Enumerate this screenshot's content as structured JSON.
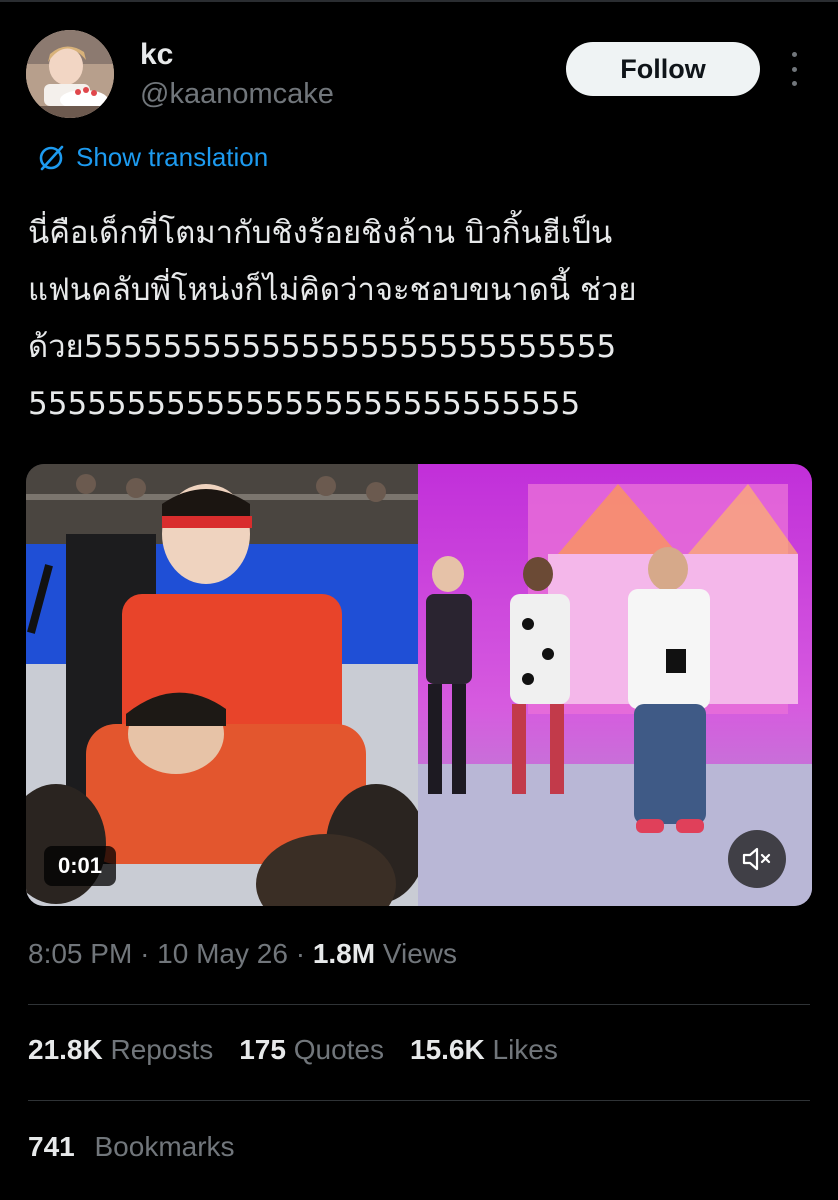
{
  "user": {
    "display_name": "kc",
    "handle": "@kaanomcake",
    "follow_label": "Follow"
  },
  "translation_label": "Show translation",
  "tweet_text": "นี่คือเด็กที่โตมากับชิงร้อยชิงล้าน บิวกิ้นฮีเป็น\nแฟนคลับพี่โหน่งก็ไม่คิดว่าจะชอบขนาดนี้ ช่วย\nด้วย555555555555555555555555555\n5555555555555555555555555555",
  "media": {
    "duration": "0:01"
  },
  "meta": {
    "time": "8:05 PM",
    "date": "10 May 26",
    "views_count": "1.8M",
    "views_label": "Views"
  },
  "stats": {
    "reposts_count": "21.8K",
    "reposts_label": "Reposts",
    "quotes_count": "175",
    "quotes_label": "Quotes",
    "likes_count": "15.6K",
    "likes_label": "Likes",
    "bookmarks_count": "741",
    "bookmarks_label": "Bookmarks"
  },
  "colors": {
    "link": "#1d9bf0",
    "muted": "#71767b",
    "text": "#e7e9ea"
  }
}
